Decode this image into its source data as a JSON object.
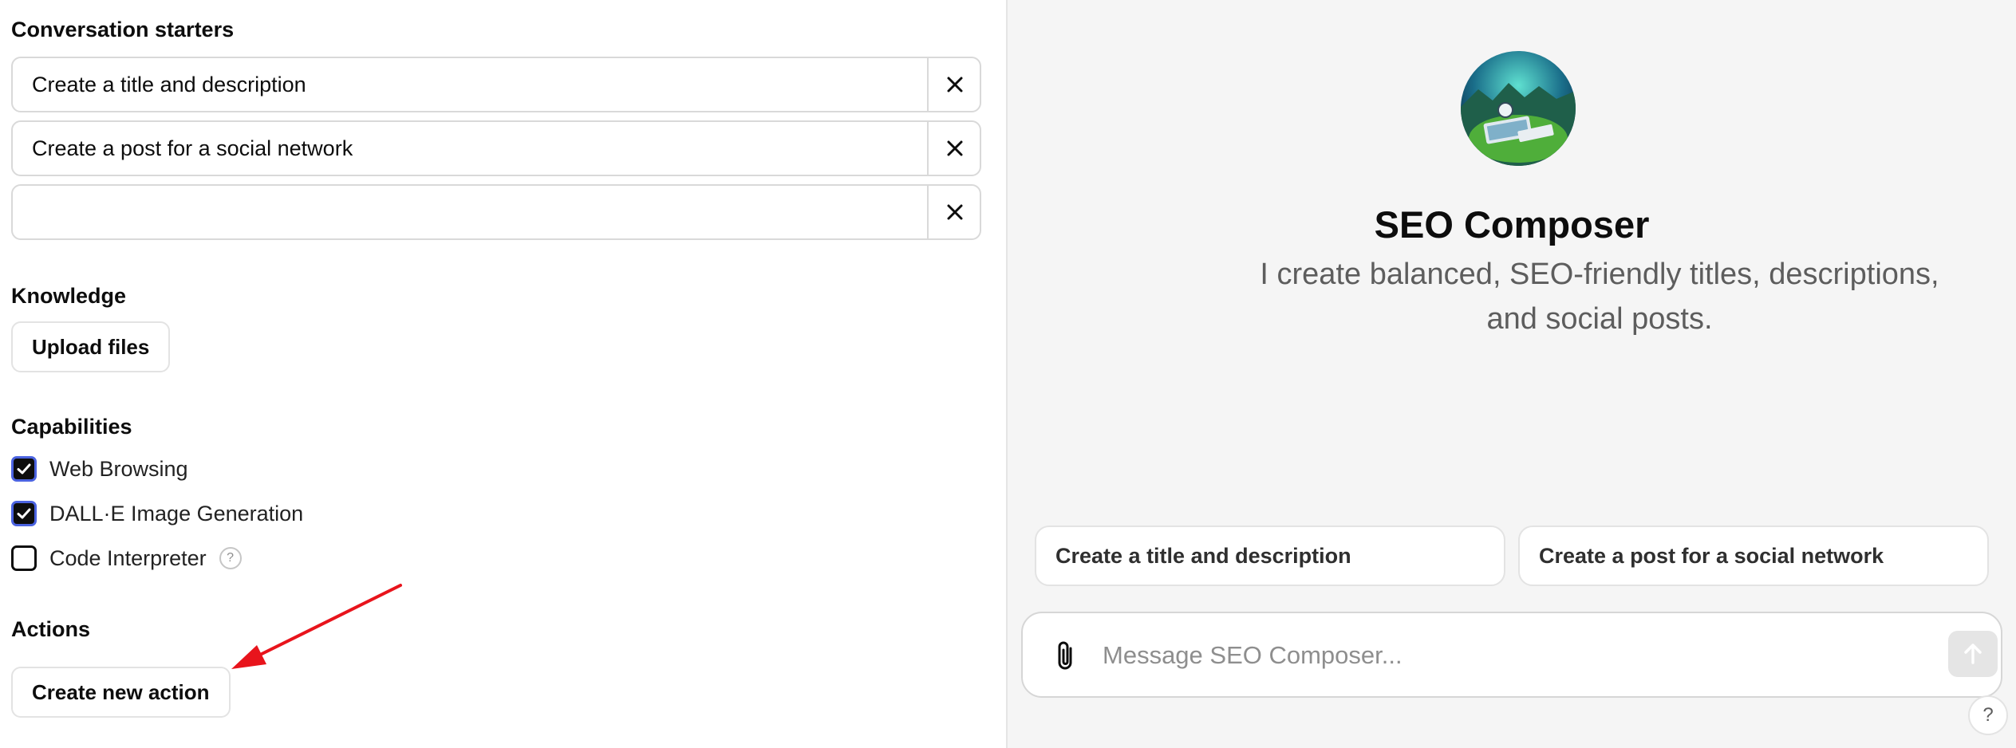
{
  "config": {
    "conversation_starters": {
      "title": "Conversation starters",
      "items": [
        {
          "value": "Create a title and description"
        },
        {
          "value": "Create a post for a social network"
        },
        {
          "value": ""
        }
      ]
    },
    "knowledge": {
      "title": "Knowledge",
      "upload_label": "Upload files"
    },
    "capabilities": {
      "title": "Capabilities",
      "items": [
        {
          "label": "Web Browsing",
          "checked": true
        },
        {
          "label": "DALL·E Image Generation",
          "checked": true
        },
        {
          "label": "Code Interpreter",
          "checked": false,
          "help": "?"
        }
      ]
    },
    "actions": {
      "title": "Actions",
      "create_label": "Create new action"
    }
  },
  "preview": {
    "name": "SEO Composer",
    "description": "I create balanced, SEO-friendly titles, descriptions, and social posts.",
    "starter_chips": [
      "Create a title and description",
      "Create a post for a social network"
    ],
    "composer": {
      "placeholder": "Message SEO Composer..."
    },
    "help_label": "?"
  },
  "colors": {
    "annotation_arrow": "#e8141c",
    "checkbox_checked": "#0d0d0d",
    "preview_background": "#f5f5f5"
  }
}
